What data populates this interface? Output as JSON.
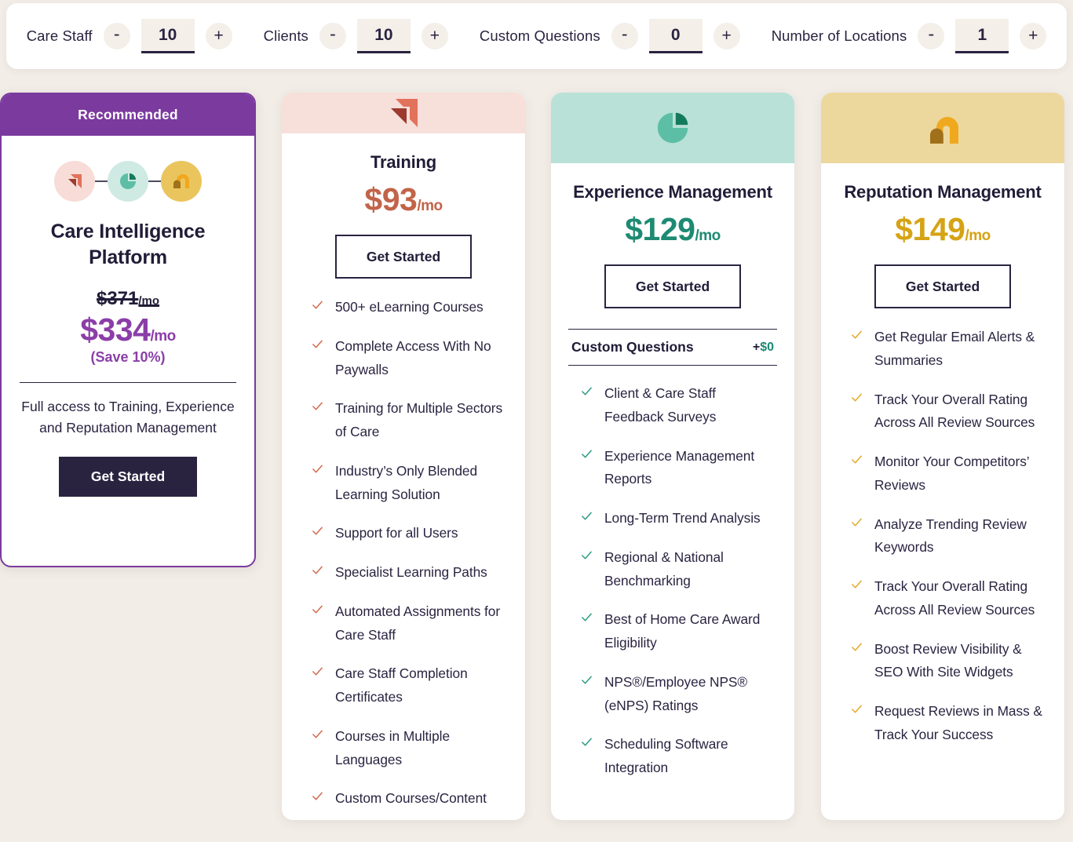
{
  "config_bar": {
    "steppers": [
      {
        "label": "Care Staff",
        "value": "10",
        "minus": "-",
        "plus": "+"
      },
      {
        "label": "Clients",
        "value": "10",
        "minus": "-",
        "plus": "+"
      },
      {
        "label": "Custom Questions",
        "value": "0",
        "minus": "-",
        "plus": "+"
      },
      {
        "label": "Number of Locations",
        "value": "1",
        "minus": "-",
        "plus": "+"
      }
    ]
  },
  "recommended_card": {
    "banner": "Recommended",
    "title": "Care Intelligence Platform",
    "old_price": "$371",
    "old_price_period": "/mo",
    "price": "$334",
    "price_period": "/mo",
    "save_note": "(Save 10%)",
    "description": "Full access to Training, Experience and Reputation Management",
    "cta": "Get Started",
    "accent_color": "#7b3a9e",
    "price_color": "#8b3ea8"
  },
  "products": [
    {
      "id": "training",
      "title": "Training",
      "price": "$93",
      "price_period": "/mo",
      "cta": "Get Started",
      "accent_color": "#c26449",
      "header_color": "#f7dfda",
      "check_color": "#cf6a4c",
      "features": [
        "500+ eLearning Courses",
        "Complete Access With No Paywalls",
        "Training for Multiple Sectors of Care",
        "Industry’s Only Blended Learning Solution",
        "Support for all Users",
        "Specialist Learning Paths",
        "Automated Assignments for Care Staff",
        "Care Staff Completion Certificates",
        "Courses in Multiple Languages",
        "Custom Courses/Content"
      ]
    },
    {
      "id": "experience",
      "title": "Experience Management",
      "price": "$129",
      "price_period": "/mo",
      "cta": "Get Started",
      "accent_color": "#1d8a72",
      "header_color": "#b9e1d7",
      "check_color": "#2e9b81",
      "custom_questions": {
        "label": "Custom Questions",
        "plus": "+",
        "amount": "$0"
      },
      "features": [
        "Client & Care Staff Feedback Surveys",
        "Experience Management Reports",
        "Long-Term Trend Analysis",
        "Regional & National Benchmarking",
        "Best of Home Care Award Eligibility",
        "NPS®/Employee NPS® (eNPS) Ratings",
        "Scheduling Software Integration"
      ]
    },
    {
      "id": "reputation",
      "title": "Reputation Management",
      "price": "$149",
      "price_period": "/mo",
      "cta": "Get Started",
      "accent_color": "#d6a315",
      "header_color": "#ecd79d",
      "check_color": "#e3a92a",
      "features": [
        "Get Regular Email Alerts & Summaries",
        "Track Your Overall Rating Across All Review Sources",
        "Monitor Your Competitors’ Reviews",
        "Analyze Trending Review Keywords",
        "Track Your Overall Rating Across All Review Sources",
        "Boost Review Visibility & SEO With Site Widgets",
        "Request Reviews in Mass & Track Your Success"
      ]
    }
  ],
  "page": {
    "background_color": "#f2ede7"
  }
}
